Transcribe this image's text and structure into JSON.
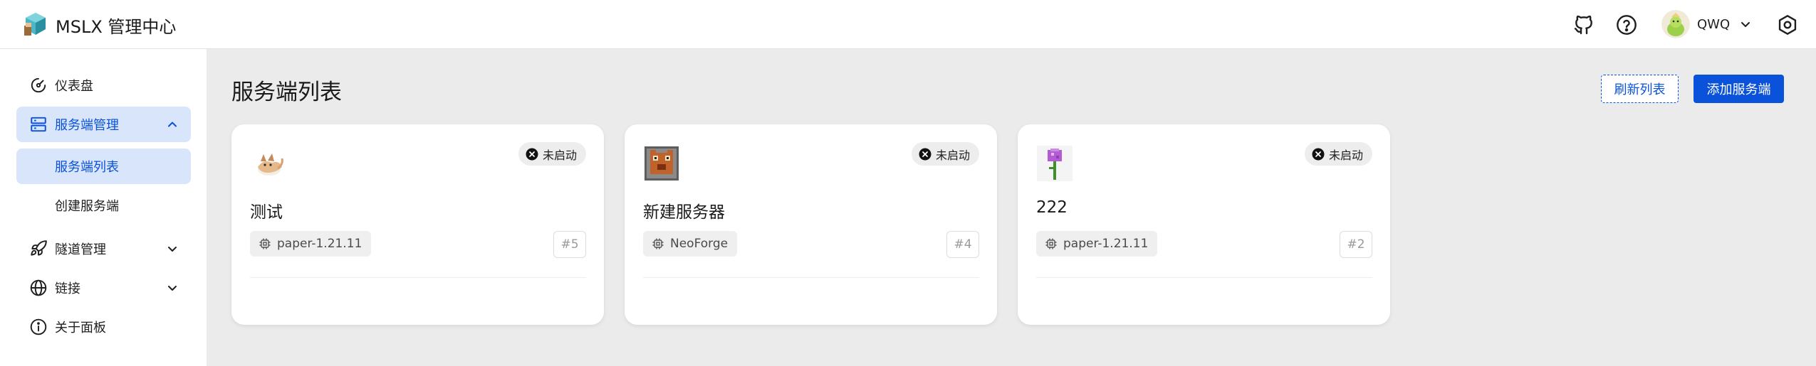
{
  "header": {
    "brand": "MSLX 管理中心",
    "username": "QWQ",
    "icons": [
      "logo-icon",
      "github-icon",
      "help-icon",
      "avatar",
      "chevron-down-icon",
      "settings-icon"
    ]
  },
  "sidebar": {
    "items": [
      {
        "label": "仪表盘",
        "icon": "dashboard-icon"
      },
      {
        "label": "服务端管理",
        "icon": "server-icon",
        "expanded": true,
        "children": [
          {
            "label": "服务端列表",
            "active": true
          },
          {
            "label": "创建服务端"
          }
        ]
      },
      {
        "label": "隧道管理",
        "icon": "rocket-icon",
        "expanded": false
      },
      {
        "label": "链接",
        "icon": "globe-icon",
        "expanded": false
      },
      {
        "label": "关于面板",
        "icon": "info-icon"
      }
    ]
  },
  "main": {
    "title": "服务端列表",
    "refresh_label": "刷新列表",
    "add_label": "添加服务端",
    "servers": [
      {
        "name": "测试",
        "status": "未启动",
        "core": "paper-1.21.11",
        "id": "#5",
        "image": "fox-image"
      },
      {
        "name": "新建服务器",
        "status": "未启动",
        "core": "NeoForge",
        "id": "#4",
        "image": "block-image"
      },
      {
        "name": "222",
        "status": "未启动",
        "core": "paper-1.21.11",
        "id": "#2",
        "image": "flower-image"
      }
    ]
  },
  "colors": {
    "accent": "#0a52d9",
    "active_bg": "#d8e5fb",
    "page_bg": "#ebebeb",
    "status_bg": "#ededed"
  }
}
